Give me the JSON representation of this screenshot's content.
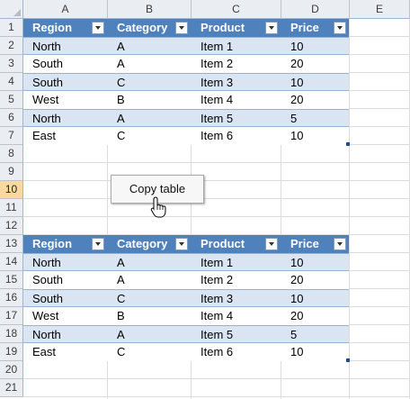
{
  "columns": [
    "A",
    "B",
    "C",
    "D",
    "E"
  ],
  "rows": [
    "1",
    "2",
    "3",
    "4",
    "5",
    "6",
    "7",
    "8",
    "9",
    "10",
    "11",
    "12",
    "13",
    "14",
    "15",
    "16",
    "17",
    "18",
    "19",
    "20",
    "21"
  ],
  "active_row": "10",
  "table1": {
    "headers": [
      "Region",
      "Category",
      "Product",
      "Price"
    ],
    "rows": [
      [
        "North",
        "A",
        "Item 1",
        "10"
      ],
      [
        "South",
        "A",
        "Item 2",
        "20"
      ],
      [
        "South",
        "C",
        "Item 3",
        "10"
      ],
      [
        "West",
        "B",
        "Item 4",
        "20"
      ],
      [
        "North",
        "A",
        "Item 5",
        "5"
      ],
      [
        "East",
        "C",
        "Item 6",
        "10"
      ]
    ]
  },
  "table2": {
    "headers": [
      "Region",
      "Category",
      "Product",
      "Price"
    ],
    "rows": [
      [
        "North",
        "A",
        "Item 1",
        "10"
      ],
      [
        "South",
        "A",
        "Item 2",
        "20"
      ],
      [
        "South",
        "C",
        "Item 3",
        "10"
      ],
      [
        "West",
        "B",
        "Item 4",
        "20"
      ],
      [
        "North",
        "A",
        "Item 5",
        "5"
      ],
      [
        "East",
        "C",
        "Item 6",
        "10"
      ]
    ]
  },
  "button": {
    "label": "Copy table"
  },
  "cursor": {
    "icon": "hand-pointer-icon"
  },
  "colors": {
    "header_blue": "#4f81bd",
    "band_blue": "#dbe5f1",
    "active_row": "#f9d99f"
  }
}
